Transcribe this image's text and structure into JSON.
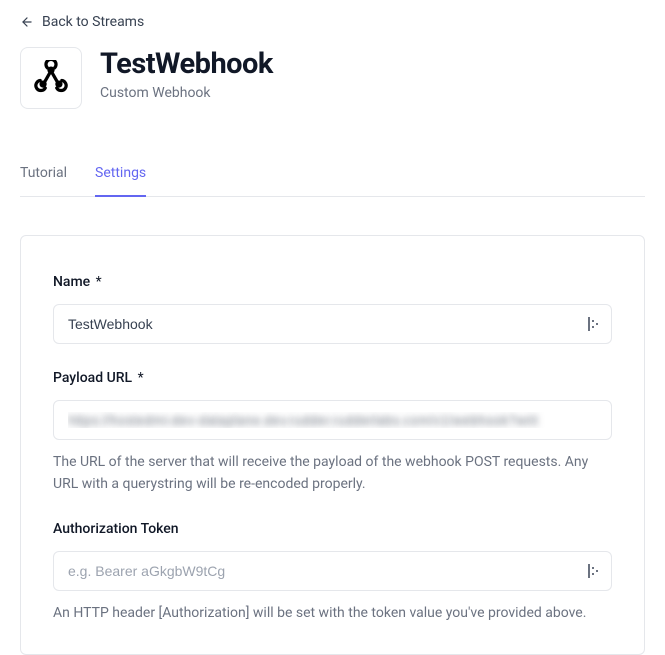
{
  "back": {
    "label": "Back to Streams"
  },
  "header": {
    "title": "TestWebhook",
    "subtitle": "Custom Webhook"
  },
  "tabs": [
    {
      "label": "Tutorial",
      "active": false
    },
    {
      "label": "Settings",
      "active": true
    }
  ],
  "form": {
    "name": {
      "label": "Name",
      "required": "*",
      "value": "TestWebhook"
    },
    "payload_url": {
      "label": "Payload URL",
      "required": "*",
      "value": "https://hostedmi-dev-dataplane.dev.rudder.rudderlabs.com/v1/webhook?writ",
      "help": "The URL of the server that will receive the payload of the webhook POST requests. Any URL with a querystring will be re-encoded properly."
    },
    "auth_token": {
      "label": "Authorization Token",
      "placeholder": "e.g. Bearer aGkgbW9tCg",
      "value": "",
      "help": "An HTTP header [Authorization] will be set with the token value you've provided above."
    }
  }
}
